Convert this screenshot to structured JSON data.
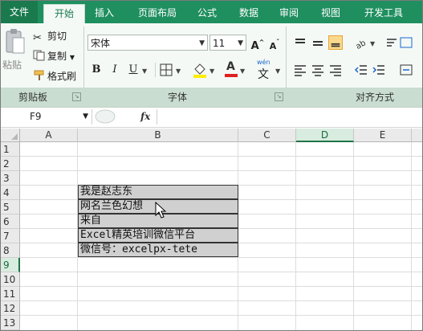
{
  "tabs": [
    "文件",
    "开始",
    "插入",
    "页面布局",
    "公式",
    "数据",
    "审阅",
    "视图",
    "开发工具"
  ],
  "clipboard": {
    "paste_label": "粘贴",
    "cut_label": "剪切",
    "copy_label": "复制",
    "format_painter_label": "格式刷",
    "group_label": "剪贴板"
  },
  "font": {
    "name_value": "宋体",
    "size_value": "11",
    "grow_label": "A",
    "shrink_label": "A",
    "bold_label": "B",
    "italic_label": "I",
    "underline_label": "U",
    "font_color_label": "A",
    "phonetic_label": "wén",
    "phonetic_char": "文",
    "group_label": "字体"
  },
  "alignment": {
    "group_label": "对齐方式"
  },
  "name_box": {
    "value": "F9"
  },
  "formula_bar": {
    "fx_label": "fx",
    "value": ""
  },
  "columns": [
    "A",
    "B",
    "C",
    "D",
    "E"
  ],
  "rows": [
    "1",
    "2",
    "3",
    "4",
    "5",
    "6",
    "7",
    "8",
    "9",
    "10",
    "11",
    "12",
    "13"
  ],
  "cells": [
    {
      "ref": "B4",
      "text": "我是赵志东"
    },
    {
      "ref": "B5",
      "text": "网名兰色幻想"
    },
    {
      "ref": "B6",
      "text": "来自"
    },
    {
      "ref": "B7",
      "text": "Excel精英培训微信平台"
    },
    {
      "ref": "B8",
      "text": "微信号：excelpx-tete"
    }
  ],
  "colors": {
    "brand": "#217346",
    "ribbon_bg": "#f4f9f6",
    "cell_fill": "#d0d0d0",
    "selected_align": "#fbd98c"
  }
}
